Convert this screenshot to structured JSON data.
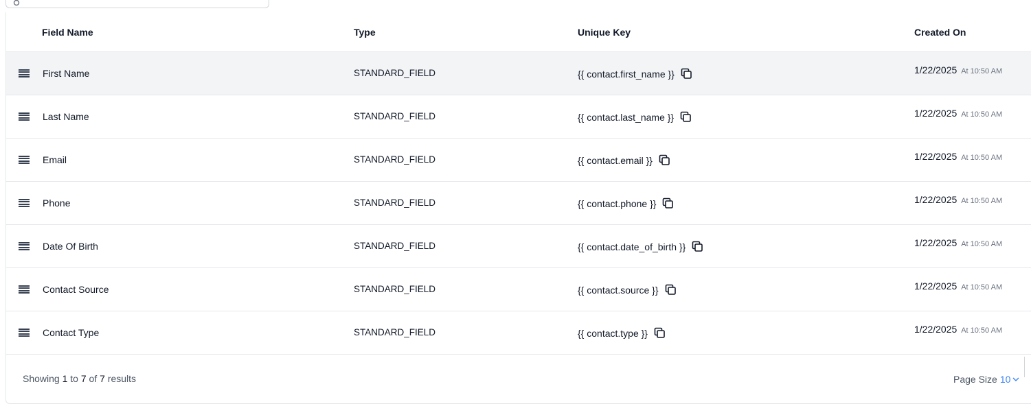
{
  "search": {
    "placeholder": ""
  },
  "table": {
    "columns": {
      "field_name": "Field Name",
      "type": "Type",
      "unique_key": "Unique Key",
      "created_on": "Created On"
    },
    "rows": [
      {
        "field_name": "First Name",
        "type": "STANDARD_FIELD",
        "unique_key": "{{ contact.first_name }}",
        "date": "1/22/2025",
        "time": "At 10:50 AM"
      },
      {
        "field_name": "Last Name",
        "type": "STANDARD_FIELD",
        "unique_key": "{{ contact.last_name }}",
        "date": "1/22/2025",
        "time": "At 10:50 AM"
      },
      {
        "field_name": "Email",
        "type": "STANDARD_FIELD",
        "unique_key": "{{ contact.email }}",
        "date": "1/22/2025",
        "time": "At 10:50 AM"
      },
      {
        "field_name": "Phone",
        "type": "STANDARD_FIELD",
        "unique_key": "{{ contact.phone }}",
        "date": "1/22/2025",
        "time": "At 10:50 AM"
      },
      {
        "field_name": "Date Of Birth",
        "type": "STANDARD_FIELD",
        "unique_key": "{{ contact.date_of_birth }}",
        "date": "1/22/2025",
        "time": "At 10:50 AM"
      },
      {
        "field_name": "Contact Source",
        "type": "STANDARD_FIELD",
        "unique_key": "{{ contact.source }}",
        "date": "1/22/2025",
        "time": "At 10:50 AM"
      },
      {
        "field_name": "Contact Type",
        "type": "STANDARD_FIELD",
        "unique_key": "{{ contact.type }}",
        "date": "1/22/2025",
        "time": "At 10:50 AM"
      }
    ]
  },
  "footer": {
    "showing_prefix": "Showing",
    "from": "1",
    "to_word": "to",
    "to": "7",
    "of_word": "of",
    "total": "7",
    "results_word": "results",
    "page_size_label": "Page Size",
    "page_size_value": "10"
  },
  "colors": {
    "accent": "#3b82f6",
    "highlight_row": "#f3f4f6",
    "border": "#e5e7eb"
  },
  "icons": {
    "drag": "drag-handle-icon",
    "copy": "copy-icon",
    "search": "search-icon",
    "chevron": "chevron-down-icon"
  }
}
